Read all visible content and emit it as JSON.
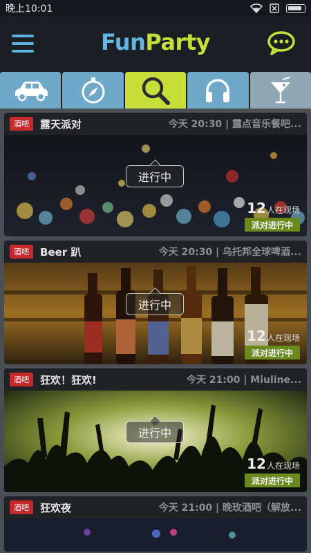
{
  "status_bar": {
    "time": "晚上10:01"
  },
  "header": {
    "title_part1": "Fun",
    "title_part2": "Party"
  },
  "tabs": [
    {
      "icon": "car-icon"
    },
    {
      "icon": "compass-icon"
    },
    {
      "icon": "search-icon",
      "active": true
    },
    {
      "icon": "headphones-icon"
    },
    {
      "icon": "cocktail-icon"
    }
  ],
  "events": [
    {
      "tag": "酒吧",
      "title": "露天派对",
      "meta": "今天 20:30 | 露点音乐餐吧...",
      "status": "进行中",
      "count": "12",
      "count_suffix": "人在现场",
      "action": "派对进行中"
    },
    {
      "tag": "酒吧",
      "title": "Beer 趴",
      "meta": "今天 20:30 | 乌托邦全球啤酒...",
      "status": "进行中",
      "count": "12",
      "count_suffix": "人在现场",
      "action": "派对进行中"
    },
    {
      "tag": "酒吧",
      "title": "狂欢！狂欢!",
      "meta": "今天 21:00 | Miuline...",
      "status": "进行中",
      "count": "12",
      "count_suffix": "人在现场",
      "action": "派对进行中"
    },
    {
      "tag": "酒吧",
      "title": "狂欢夜",
      "meta": "今天 21:00 | 晚玫酒吧（解放..."
    }
  ],
  "colors": {
    "accent_green": "#c5de3a",
    "accent_blue": "#64b4e3",
    "tag_red": "#c8292c",
    "action_green": "#6b8a1e"
  }
}
